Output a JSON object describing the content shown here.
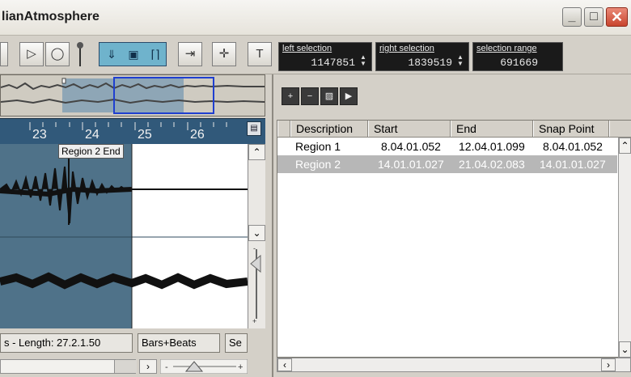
{
  "window": {
    "title": "lianAtmosphere"
  },
  "toolbar": {
    "left_selection_label": "left selection",
    "left_selection_value": "1147851",
    "right_selection_label": "right selection",
    "right_selection_value": "1839519",
    "selection_range_label": "selection range",
    "selection_range_value": "691669"
  },
  "ruler": {
    "ticks": [
      "23",
      "24",
      "25",
      "26"
    ]
  },
  "waveform": {
    "marker_label": "Region 2 End"
  },
  "status": {
    "length_text": "s - Length:  27.2.1.50",
    "format": "Bars+Beats",
    "extra": "Se"
  },
  "regions_table": {
    "columns": [
      "Description",
      "Start",
      "End",
      "Snap Point"
    ],
    "rows": [
      {
        "description": "Region 1",
        "start": "8.04.01.052",
        "end": "12.04.01.099",
        "snap": "8.04.01.052",
        "selected": false
      },
      {
        "description": "Region 2",
        "start": "14.01.01.027",
        "end": "21.04.02.083",
        "snap": "14.01.01.027",
        "selected": true
      }
    ]
  },
  "colors": {
    "ruler": "#31597a",
    "waveform_bg": "#4f7289",
    "toolbar_accent": "#6fb3cc",
    "selected_row": "#b7b7b7"
  }
}
